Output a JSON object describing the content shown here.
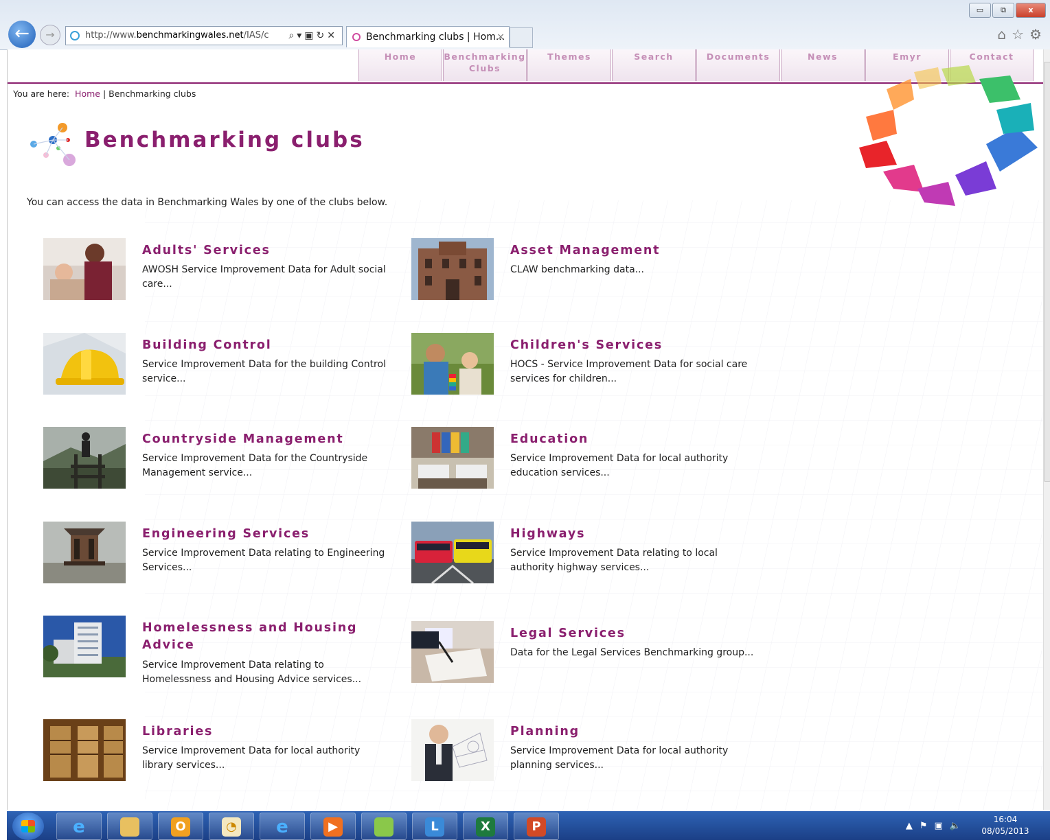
{
  "browser": {
    "address": {
      "prefix": "http://www.",
      "domain": "benchmarkingwales.net",
      "path": "/IAS/c"
    },
    "tab_title": "Benchmarking clubs | Hom...",
    "tab_close": "×",
    "window_buttons": {
      "minimize": "▭",
      "restore": "⧉",
      "close": "x"
    },
    "icons": [
      "home-icon",
      "favorites-star-icon",
      "settings-gear-icon"
    ]
  },
  "nav": {
    "items": [
      {
        "label": "Home"
      },
      {
        "label": "Benchmarking",
        "label2": "Clubs"
      },
      {
        "label": "Themes"
      },
      {
        "label": "Search"
      },
      {
        "label": "Documents"
      },
      {
        "label": "News"
      },
      {
        "label": "Emyr"
      },
      {
        "label": "Contact"
      }
    ]
  },
  "breadcrumb": {
    "prefix": "You are here:",
    "home": "Home",
    "separator": "|",
    "current": "Benchmarking clubs"
  },
  "page": {
    "title": "Benchmarking clubs",
    "intro": "You can access the data in Benchmarking Wales by one of the clubs below."
  },
  "clubs": [
    {
      "title": "Adults' Services",
      "desc": "AWOSH Service Improvement Data for Adult social care..."
    },
    {
      "title": "Asset Management",
      "desc": "CLAW benchmarking data..."
    },
    {
      "title": "Building Control",
      "desc": "Service Improvement Data for the building Control service..."
    },
    {
      "title": "Children's Services",
      "desc": "HOCS - Service Improvement Data for social care services for children..."
    },
    {
      "title": "Countryside Management",
      "desc": "Service Improvement Data for the Countryside Management service..."
    },
    {
      "title": "Education",
      "desc": "Service Improvement Data for local authority education services..."
    },
    {
      "title": "Engineering Services",
      "desc": "Service Improvement Data relating to Engineering Services..."
    },
    {
      "title": "Highways",
      "desc": "Service Improvement Data relating to local authority highway services..."
    },
    {
      "title": "Homelessness and Housing Advice",
      "desc": "Service Improvement Data relating to Homelessness and Housing Advice services..."
    },
    {
      "title": "Legal Services",
      "desc": "Data for the Legal Services Benchmarking group..."
    },
    {
      "title": "Libraries",
      "desc": "Service Improvement Data for local authority library services..."
    },
    {
      "title": "Planning",
      "desc": "Service Improvement Data for local authority planning services..."
    }
  ],
  "taskbar": {
    "time": "16:04",
    "date": "08/05/2013",
    "apps": [
      "internet-explorer-icon",
      "file-explorer-icon",
      "outlook-icon",
      "clock-app-icon",
      "internet-explorer-icon",
      "media-player-icon",
      "folder-icon",
      "lync-icon",
      "excel-icon",
      "powerpoint-icon"
    ]
  },
  "colors": {
    "brand": "#8a1f6e",
    "taskbar": "#1b3f86"
  }
}
